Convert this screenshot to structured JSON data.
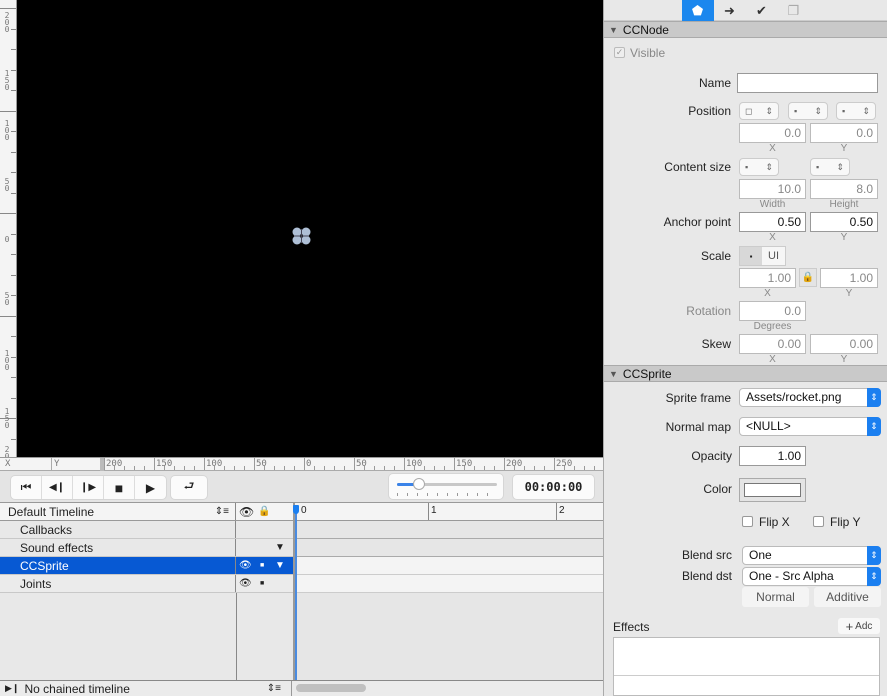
{
  "canvas": {
    "background": "#000000",
    "vertical_ruler_labels": [
      "200",
      "150",
      "100",
      "50",
      "0",
      "50",
      "100",
      "150",
      "200"
    ],
    "horizontal_ruler": {
      "axis_x": "X",
      "axis_y": "Y",
      "labels": [
        "200",
        "150",
        "100",
        "50",
        "0",
        "50",
        "100",
        "150",
        "200",
        "250"
      ]
    },
    "node_icon": "sprite-node-icon"
  },
  "transport": {
    "buttons": [
      {
        "name": "jump-to-start",
        "glyph": "⏮"
      },
      {
        "name": "step-back",
        "glyph": "◀❙"
      },
      {
        "name": "step-forward",
        "glyph": "❙▶"
      },
      {
        "name": "stop",
        "glyph": "■"
      },
      {
        "name": "play",
        "glyph": "▶"
      }
    ],
    "loop_glyph": "⮐",
    "zoom_level": 0.22,
    "timecode": "00:00:00"
  },
  "timeline": {
    "selector_label": "Default Timeline",
    "header_icons": {
      "eye": "👁",
      "lock": "🔒"
    },
    "rows": [
      {
        "label": "Callbacks",
        "eye": false,
        "dot": false,
        "arrow": false,
        "selected": false
      },
      {
        "label": "Sound effects",
        "eye": false,
        "dot": false,
        "arrow": true,
        "selected": false
      },
      {
        "label": "CCSprite",
        "eye": true,
        "dot": true,
        "arrow": true,
        "selected": true
      },
      {
        "label": "Joints",
        "eye": true,
        "dot": true,
        "arrow": false,
        "selected": false
      }
    ],
    "ruler_labels": [
      "0",
      "1",
      "2"
    ],
    "chained_label": "No chained timeline"
  },
  "inspector": {
    "tabs": [
      {
        "name": "properties",
        "glyph": "◆",
        "active": true
      },
      {
        "name": "code-connections",
        "glyph": "➜",
        "active": false
      },
      {
        "name": "physics",
        "glyph": "✔",
        "active": false
      },
      {
        "name": "templates",
        "glyph": "❐",
        "active": false
      }
    ],
    "ccnode": {
      "title": "CCNode",
      "visible_label": "Visible",
      "visible_checked": true,
      "name_label": "Name",
      "name_value": "",
      "position_label": "Position",
      "position_x": "0.0",
      "position_y": "0.0",
      "x_label": "X",
      "y_label": "Y",
      "content_size_label": "Content size",
      "content_width": "10.0",
      "content_height": "8.0",
      "width_label": "Width",
      "height_label": "Height",
      "anchor_label": "Anchor point",
      "anchor_x": "0.50",
      "anchor_y": "0.50",
      "scale_label": "Scale",
      "scale_ui_label": "UI",
      "scale_x": "1.00",
      "scale_y": "1.00",
      "rotation_label": "Rotation",
      "rotation_value": "0.0",
      "degrees_label": "Degrees",
      "skew_label": "Skew",
      "skew_x": "0.00",
      "skew_y": "0.00"
    },
    "ccsprite": {
      "title": "CCSprite",
      "sprite_frame_label": "Sprite frame",
      "sprite_frame_value": "Assets/rocket.png",
      "normal_map_label": "Normal map",
      "normal_map_value": "<NULL>",
      "opacity_label": "Opacity",
      "opacity_value": "1.00",
      "color_label": "Color",
      "color_value": "#ffffff",
      "flip_x_label": "Flip X",
      "flip_y_label": "Flip Y",
      "blend_src_label": "Blend src",
      "blend_src_value": "One",
      "blend_dst_label": "Blend dst",
      "blend_dst_value": "One - Src Alpha",
      "normal_button": "Normal",
      "additive_button": "Additive",
      "effects_label": "Effects",
      "add_button": "Adc"
    },
    "accent_color": "#1b87ee"
  }
}
